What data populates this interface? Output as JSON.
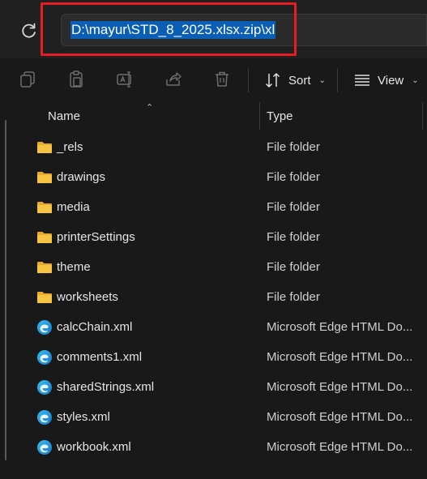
{
  "address_bar": {
    "path": "D:\\mayur\\STD_8_2025.xlsx.zip\\xl",
    "refresh_icon": "refresh-icon"
  },
  "toolbar": {
    "icons": [
      "copy-icon",
      "paste-icon",
      "rename-icon",
      "share-icon",
      "delete-icon"
    ],
    "sort_label": "Sort",
    "view_label": "View"
  },
  "columns": {
    "name": "Name",
    "type": "Type"
  },
  "files": [
    {
      "name": "_rels",
      "type": "File folder",
      "icon": "folder-icon"
    },
    {
      "name": "drawings",
      "type": "File folder",
      "icon": "folder-icon"
    },
    {
      "name": "media",
      "type": "File folder",
      "icon": "folder-icon"
    },
    {
      "name": "printerSettings",
      "type": "File folder",
      "icon": "folder-icon"
    },
    {
      "name": "theme",
      "type": "File folder",
      "icon": "folder-icon"
    },
    {
      "name": "worksheets",
      "type": "File folder",
      "icon": "folder-icon"
    },
    {
      "name": "calcChain.xml",
      "type": "Microsoft Edge HTML Do...",
      "icon": "edge-icon"
    },
    {
      "name": "comments1.xml",
      "type": "Microsoft Edge HTML Do...",
      "icon": "edge-icon"
    },
    {
      "name": "sharedStrings.xml",
      "type": "Microsoft Edge HTML Do...",
      "icon": "edge-icon"
    },
    {
      "name": "styles.xml",
      "type": "Microsoft Edge HTML Do...",
      "icon": "edge-icon"
    },
    {
      "name": "workbook.xml",
      "type": "Microsoft Edge HTML Do...",
      "icon": "edge-icon"
    }
  ],
  "colors": {
    "selection": "#0a5fb4",
    "highlight_box": "#e81c24",
    "folder": "#f6c343"
  }
}
